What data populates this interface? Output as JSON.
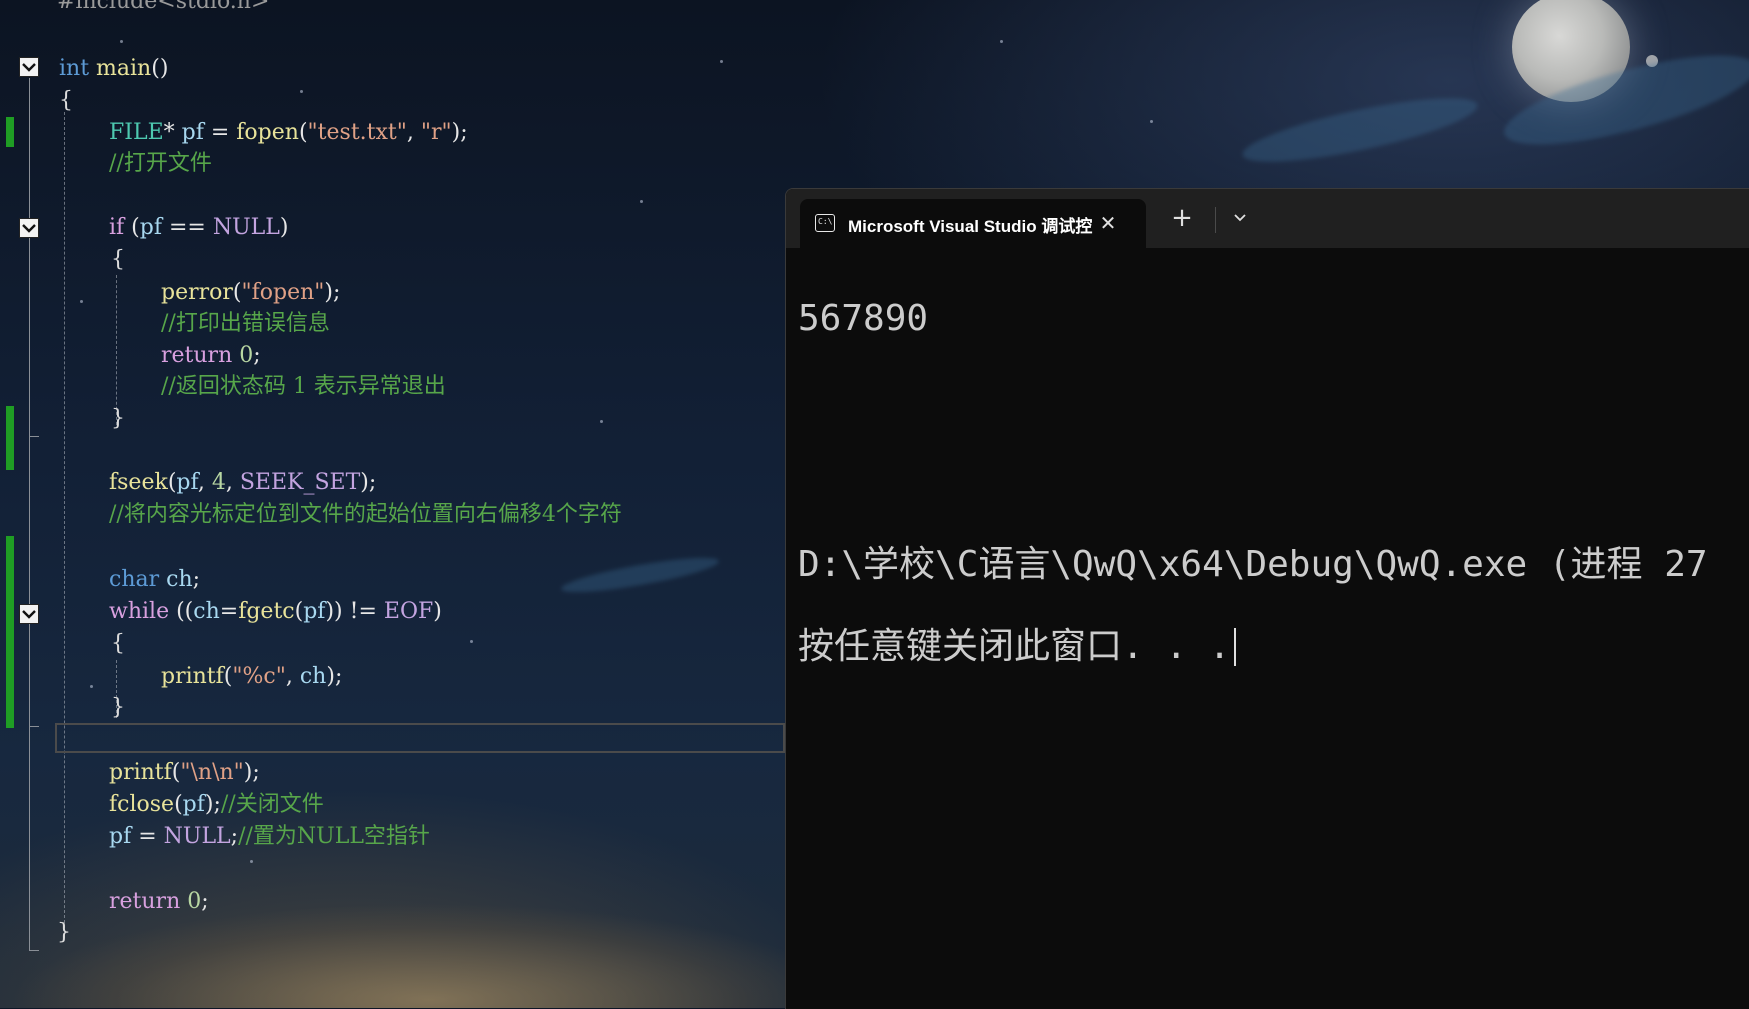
{
  "editor": {
    "lines": {
      "include": "#include<stdio.h>",
      "main_kw": "int",
      "main_name": "main",
      "main_paren": "()",
      "open1": "{",
      "l1_type": "FILE",
      "l1_rest_a": "* ",
      "l1_var": "pf",
      "l1_eq": " = ",
      "l1_fn": "fopen",
      "l1_p1": "(",
      "l1_s1": "\"test.txt\"",
      "l1_c": ", ",
      "l1_s2": "\"r\"",
      "l1_end": ");",
      "c1": "//打开文件",
      "if_kw": "if",
      "if_a": " (",
      "if_var": "pf",
      "if_op": " == ",
      "if_null": "NULL",
      "if_end": ")",
      "open2": "{",
      "perror_fn": "perror",
      "perror_p": "(",
      "perror_s": "\"fopen\"",
      "perror_end": ");",
      "c2": "//打印出错误信息",
      "ret1_kw": "return",
      "ret1_num": " 0",
      "ret1_end": ";",
      "c3": "//返回状态码 1 表示异常退出",
      "close2": "}",
      "fseek_fn": "fseek",
      "fseek_p": "(",
      "fseek_var": "pf",
      "fseek_c1": ", ",
      "fseek_num": "4",
      "fseek_c2": ", ",
      "fseek_mac": "SEEK_SET",
      "fseek_end": ");",
      "c4": "//将内容光标定位到文件的起始位置向右偏移4个字符",
      "char_kw": "char",
      "char_var": " ch",
      "char_end": ";",
      "while_kw": "while",
      "while_a": " ((",
      "while_var": "ch",
      "while_eq": "=",
      "while_fn": "fgetc",
      "while_p": "(",
      "while_var2": "pf",
      "while_b": ")) != ",
      "while_eof": "EOF",
      "while_end": ")",
      "open3": "{",
      "printf1_fn": "printf",
      "printf1_p": "(",
      "printf1_s": "\"%c\"",
      "printf1_c": ", ",
      "printf1_var": "ch",
      "printf1_end": ");",
      "close3": "}",
      "printf2_fn": "printf",
      "printf2_p": "(",
      "printf2_s": "\"\\n\\n\"",
      "printf2_end": ");",
      "fclose_fn": "fclose",
      "fclose_p": "(",
      "fclose_var": "pf",
      "fclose_end": ");",
      "c5": "//关闭文件",
      "pfnull_var": "pf",
      "pfnull_eq": " = ",
      "pfnull_null": "NULL",
      "pfnull_end": ";",
      "c6": "//置为NULL空指针",
      "ret2_kw": "return",
      "ret2_num": " 0",
      "ret2_end": ";",
      "close1": "}"
    }
  },
  "terminal": {
    "tab_title": "Microsoft Visual Studio 调试控",
    "tab_icon_text": "C:\\",
    "close_glyph": "✕",
    "new_tab_glyph": "+",
    "output": {
      "line1": "567890",
      "line2": "",
      "line3": "",
      "line4": "D:\\学校\\C语言\\QwQ\\x64\\Debug\\QwQ.exe (进程 27",
      "line5": "按任意键关闭此窗口. . ."
    }
  },
  "colors": {
    "change_bar": "#1f9d24",
    "terminal_bg": "#0c0c0c",
    "titlebar_bg": "#202020"
  }
}
